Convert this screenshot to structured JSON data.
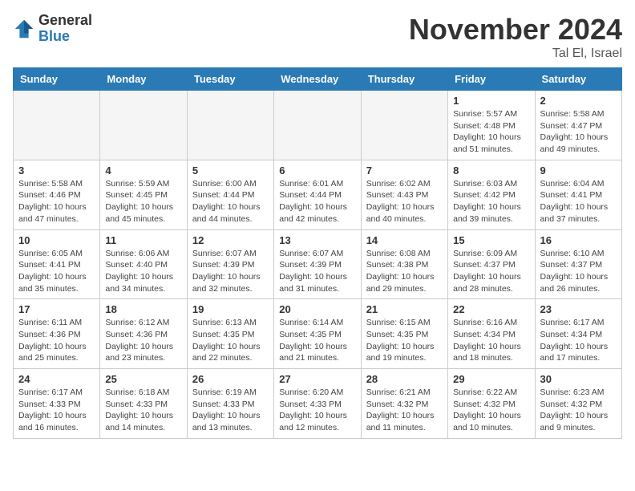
{
  "header": {
    "logo_general": "General",
    "logo_blue": "Blue",
    "month_title": "November 2024",
    "location": "Tal El, Israel"
  },
  "weekdays": [
    "Sunday",
    "Monday",
    "Tuesday",
    "Wednesday",
    "Thursday",
    "Friday",
    "Saturday"
  ],
  "weeks": [
    [
      {
        "day": "",
        "info": ""
      },
      {
        "day": "",
        "info": ""
      },
      {
        "day": "",
        "info": ""
      },
      {
        "day": "",
        "info": ""
      },
      {
        "day": "",
        "info": ""
      },
      {
        "day": "1",
        "info": "Sunrise: 5:57 AM\nSunset: 4:48 PM\nDaylight: 10 hours\nand 51 minutes."
      },
      {
        "day": "2",
        "info": "Sunrise: 5:58 AM\nSunset: 4:47 PM\nDaylight: 10 hours\nand 49 minutes."
      }
    ],
    [
      {
        "day": "3",
        "info": "Sunrise: 5:58 AM\nSunset: 4:46 PM\nDaylight: 10 hours\nand 47 minutes."
      },
      {
        "day": "4",
        "info": "Sunrise: 5:59 AM\nSunset: 4:45 PM\nDaylight: 10 hours\nand 45 minutes."
      },
      {
        "day": "5",
        "info": "Sunrise: 6:00 AM\nSunset: 4:44 PM\nDaylight: 10 hours\nand 44 minutes."
      },
      {
        "day": "6",
        "info": "Sunrise: 6:01 AM\nSunset: 4:44 PM\nDaylight: 10 hours\nand 42 minutes."
      },
      {
        "day": "7",
        "info": "Sunrise: 6:02 AM\nSunset: 4:43 PM\nDaylight: 10 hours\nand 40 minutes."
      },
      {
        "day": "8",
        "info": "Sunrise: 6:03 AM\nSunset: 4:42 PM\nDaylight: 10 hours\nand 39 minutes."
      },
      {
        "day": "9",
        "info": "Sunrise: 6:04 AM\nSunset: 4:41 PM\nDaylight: 10 hours\nand 37 minutes."
      }
    ],
    [
      {
        "day": "10",
        "info": "Sunrise: 6:05 AM\nSunset: 4:41 PM\nDaylight: 10 hours\nand 35 minutes."
      },
      {
        "day": "11",
        "info": "Sunrise: 6:06 AM\nSunset: 4:40 PM\nDaylight: 10 hours\nand 34 minutes."
      },
      {
        "day": "12",
        "info": "Sunrise: 6:07 AM\nSunset: 4:39 PM\nDaylight: 10 hours\nand 32 minutes."
      },
      {
        "day": "13",
        "info": "Sunrise: 6:07 AM\nSunset: 4:39 PM\nDaylight: 10 hours\nand 31 minutes."
      },
      {
        "day": "14",
        "info": "Sunrise: 6:08 AM\nSunset: 4:38 PM\nDaylight: 10 hours\nand 29 minutes."
      },
      {
        "day": "15",
        "info": "Sunrise: 6:09 AM\nSunset: 4:37 PM\nDaylight: 10 hours\nand 28 minutes."
      },
      {
        "day": "16",
        "info": "Sunrise: 6:10 AM\nSunset: 4:37 PM\nDaylight: 10 hours\nand 26 minutes."
      }
    ],
    [
      {
        "day": "17",
        "info": "Sunrise: 6:11 AM\nSunset: 4:36 PM\nDaylight: 10 hours\nand 25 minutes."
      },
      {
        "day": "18",
        "info": "Sunrise: 6:12 AM\nSunset: 4:36 PM\nDaylight: 10 hours\nand 23 minutes."
      },
      {
        "day": "19",
        "info": "Sunrise: 6:13 AM\nSunset: 4:35 PM\nDaylight: 10 hours\nand 22 minutes."
      },
      {
        "day": "20",
        "info": "Sunrise: 6:14 AM\nSunset: 4:35 PM\nDaylight: 10 hours\nand 21 minutes."
      },
      {
        "day": "21",
        "info": "Sunrise: 6:15 AM\nSunset: 4:35 PM\nDaylight: 10 hours\nand 19 minutes."
      },
      {
        "day": "22",
        "info": "Sunrise: 6:16 AM\nSunset: 4:34 PM\nDaylight: 10 hours\nand 18 minutes."
      },
      {
        "day": "23",
        "info": "Sunrise: 6:17 AM\nSunset: 4:34 PM\nDaylight: 10 hours\nand 17 minutes."
      }
    ],
    [
      {
        "day": "24",
        "info": "Sunrise: 6:17 AM\nSunset: 4:33 PM\nDaylight: 10 hours\nand 16 minutes."
      },
      {
        "day": "25",
        "info": "Sunrise: 6:18 AM\nSunset: 4:33 PM\nDaylight: 10 hours\nand 14 minutes."
      },
      {
        "day": "26",
        "info": "Sunrise: 6:19 AM\nSunset: 4:33 PM\nDaylight: 10 hours\nand 13 minutes."
      },
      {
        "day": "27",
        "info": "Sunrise: 6:20 AM\nSunset: 4:33 PM\nDaylight: 10 hours\nand 12 minutes."
      },
      {
        "day": "28",
        "info": "Sunrise: 6:21 AM\nSunset: 4:32 PM\nDaylight: 10 hours\nand 11 minutes."
      },
      {
        "day": "29",
        "info": "Sunrise: 6:22 AM\nSunset: 4:32 PM\nDaylight: 10 hours\nand 10 minutes."
      },
      {
        "day": "30",
        "info": "Sunrise: 6:23 AM\nSunset: 4:32 PM\nDaylight: 10 hours\nand 9 minutes."
      }
    ]
  ]
}
